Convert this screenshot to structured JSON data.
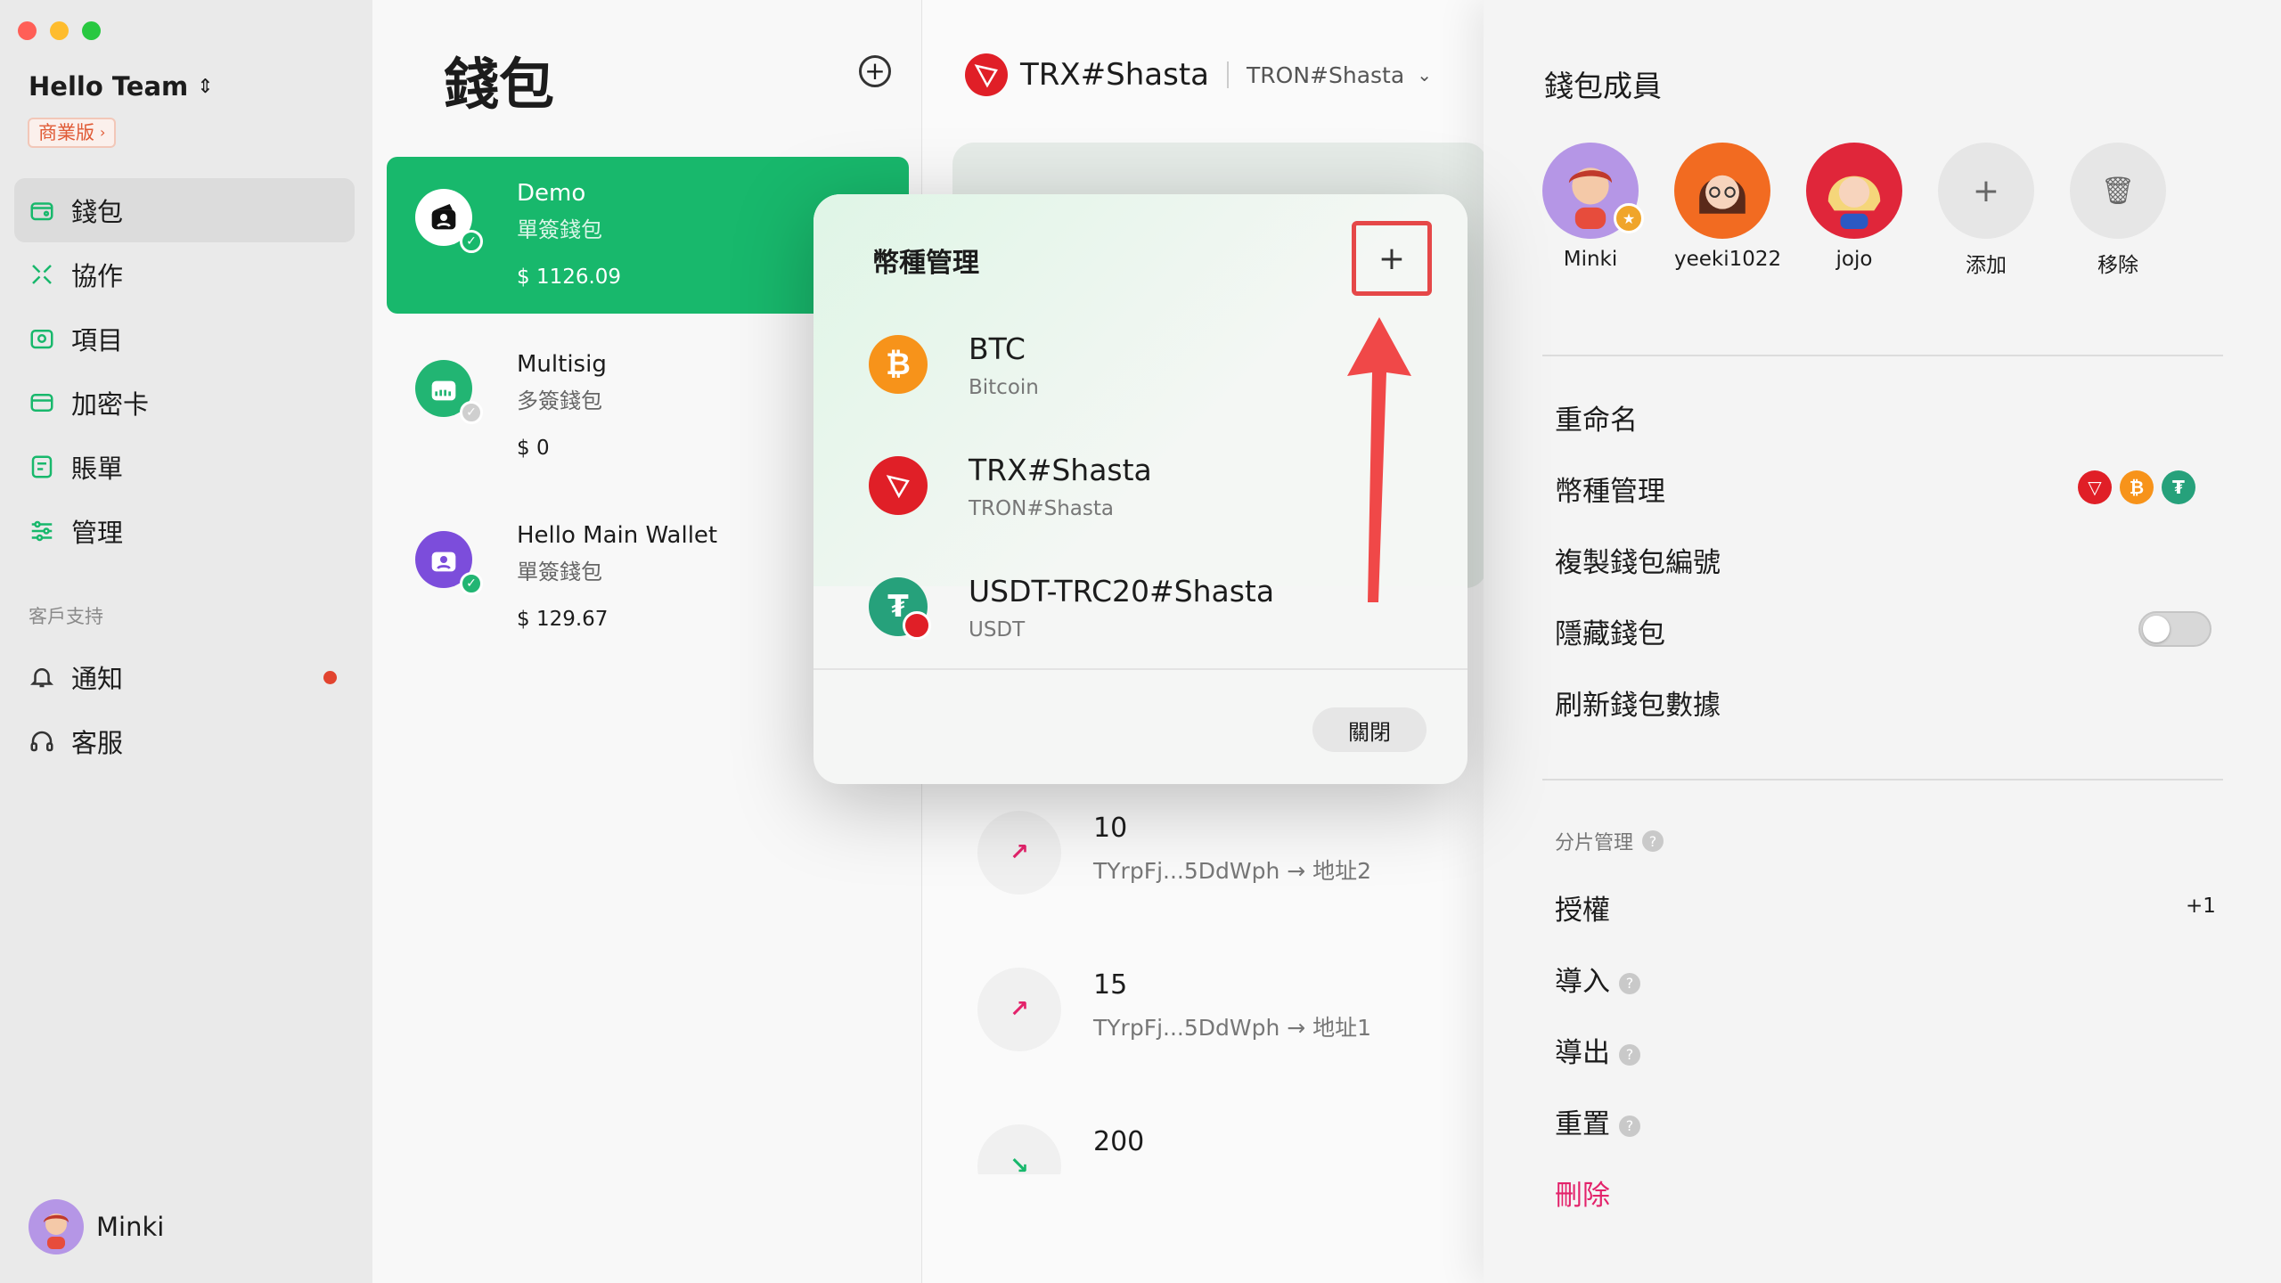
{
  "sidebar": {
    "team_name": "Hello Team",
    "plan_badge": "商業版",
    "nav": [
      {
        "label": "錢包",
        "icon": "wallet-icon",
        "active": true
      },
      {
        "label": "協作",
        "icon": "collaborate-icon",
        "active": false
      },
      {
        "label": "項目",
        "icon": "project-icon",
        "active": false
      },
      {
        "label": "加密卡",
        "icon": "card-icon",
        "active": false
      },
      {
        "label": "賬單",
        "icon": "bill-icon",
        "active": false
      },
      {
        "label": "管理",
        "icon": "sliders-icon",
        "active": false
      }
    ],
    "support_label": "客戶支持",
    "support": [
      {
        "label": "通知",
        "icon": "bell-icon",
        "unread": true
      },
      {
        "label": "客服",
        "icon": "headphones-icon",
        "unread": false
      }
    ],
    "user_name": "Minki"
  },
  "wallet_list": {
    "title": "錢包",
    "wallets": [
      {
        "name": "Demo",
        "type": "單簽錢包",
        "balance": "$ 1126.09",
        "active": true
      },
      {
        "name": "Multisig",
        "type": "多簽錢包",
        "balance": "$ 0",
        "active": false
      },
      {
        "name": "Hello Main Wallet",
        "type": "單簽錢包",
        "balance": "$ 129.67",
        "active": false
      }
    ]
  },
  "tx_column": {
    "chain_name": "TRX#Shasta",
    "network_label": "TRON#Shasta",
    "transactions": [
      {
        "amount": "10",
        "desc": "TYrpFj...5DdWph → 地址2",
        "direction": "out"
      },
      {
        "amount": "15",
        "desc": "TYrpFj...5DdWph → 地址1",
        "direction": "out"
      },
      {
        "amount": "200",
        "desc": "",
        "direction": "in"
      }
    ]
  },
  "modal": {
    "title": "幣種管理",
    "add_label": "+",
    "coins": [
      {
        "name": "BTC",
        "sub": "Bitcoin",
        "icon": "bitcoin-icon",
        "color": "#f7931a"
      },
      {
        "name": "TRX#Shasta",
        "sub": "TRON#Shasta",
        "icon": "tron-icon",
        "color": "#e01f27"
      },
      {
        "name": "USDT-TRC20#Shasta",
        "sub": "USDT",
        "icon": "tether-icon",
        "color": "#26a17b"
      }
    ],
    "close_label": "關閉"
  },
  "right_panel": {
    "title": "錢包成員",
    "members": [
      {
        "name": "Minki",
        "owner": true
      },
      {
        "name": "yeeki1022",
        "owner": false
      },
      {
        "name": "jojo",
        "owner": false
      }
    ],
    "add_member_label": "添加",
    "remove_member_label": "移除",
    "actions": {
      "rename": "重命名",
      "coin_manage": "幣種管理",
      "copy_id": "複製錢包編號",
      "hide": "隱藏錢包",
      "refresh": "刷新錢包數據"
    },
    "hide_enabled": false,
    "shard_label": "分片管理",
    "shard_actions": {
      "authorize": "授權",
      "authorize_count": "+1",
      "import": "導入",
      "export": "導出",
      "reset": "重置",
      "delete": "刪除"
    }
  },
  "colors": {
    "accent_green": "#18b86c",
    "danger": "#e3236b",
    "highlight_red": "#e54848"
  }
}
